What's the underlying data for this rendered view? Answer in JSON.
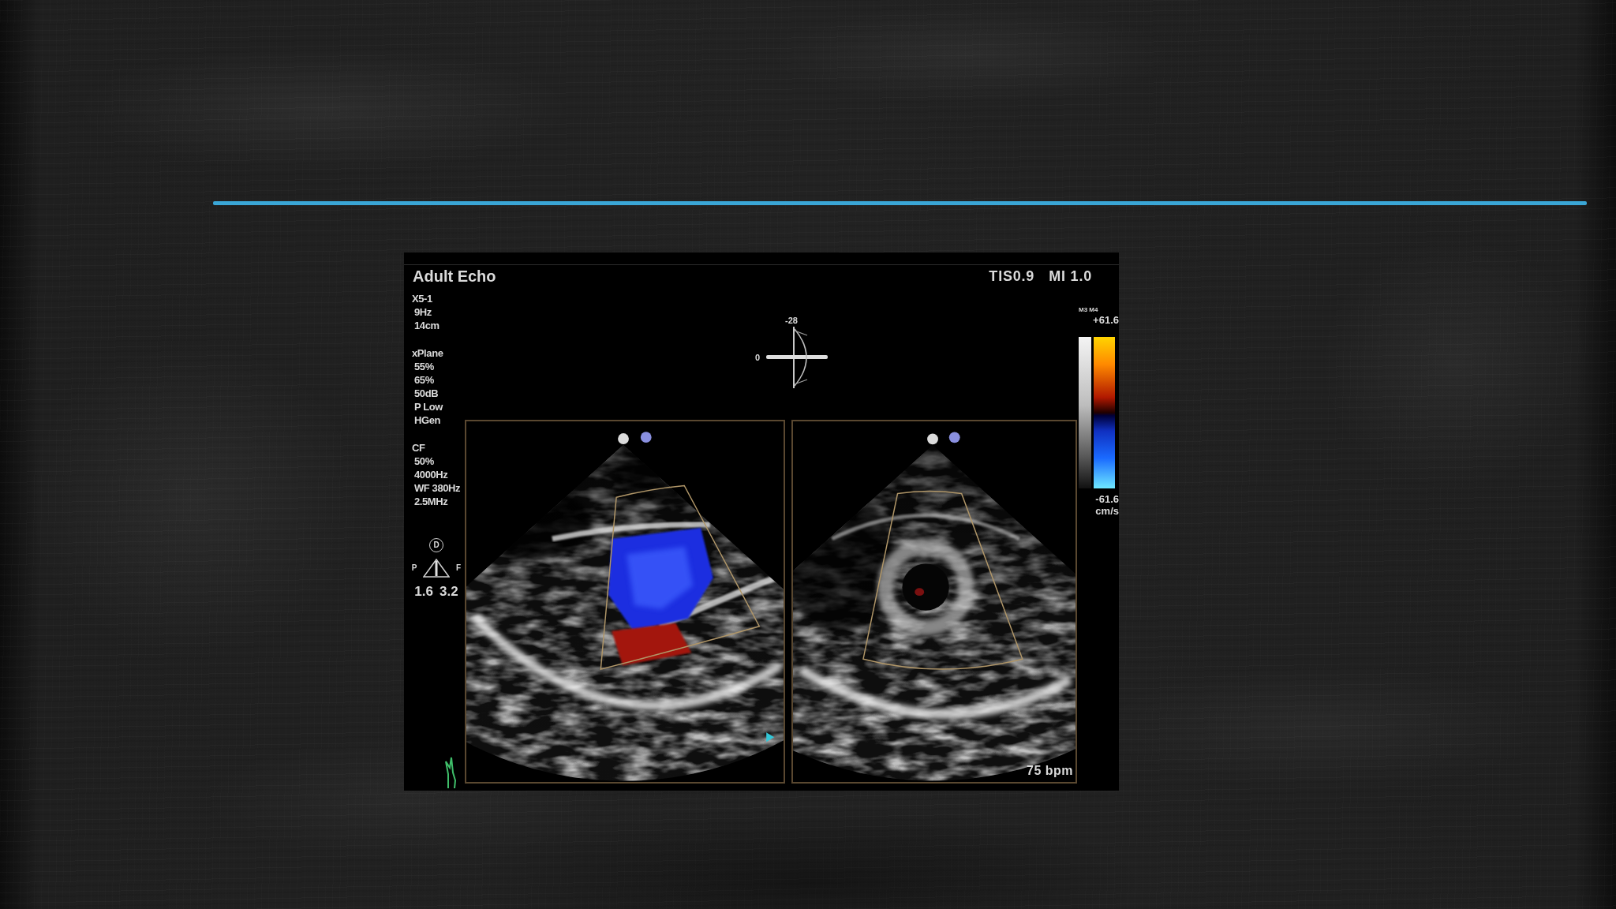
{
  "slide": {
    "display": {
      "title": "Adult Echo",
      "safety_indices": [
        "TIS0.9",
        "MI 1.0"
      ],
      "settings": [
        [
          "X5-1",
          "9Hz",
          "14cm"
        ],
        [
          "xPlane",
          "55%",
          "65%",
          "50dB",
          "P Low",
          "HGen"
        ],
        [
          "CF",
          "50%",
          "4000Hz",
          "WF 380Hz",
          "2.5MHz"
        ]
      ],
      "probe_marker": {
        "letter": "D",
        "left": "P",
        "right": "F",
        "values": [
          "1.6",
          "3.2"
        ]
      },
      "plane_marker": {
        "angle": "-28",
        "origin": "0"
      },
      "color_scale": {
        "label": "M3 M4",
        "max": "+61.6",
        "min": "-61.6",
        "unit": "cm/s"
      },
      "images": [
        {
          "kind": "doppler"
        },
        {
          "kind": "grayscale"
        }
      ],
      "heart_rate": "75 bpm"
    }
  }
}
